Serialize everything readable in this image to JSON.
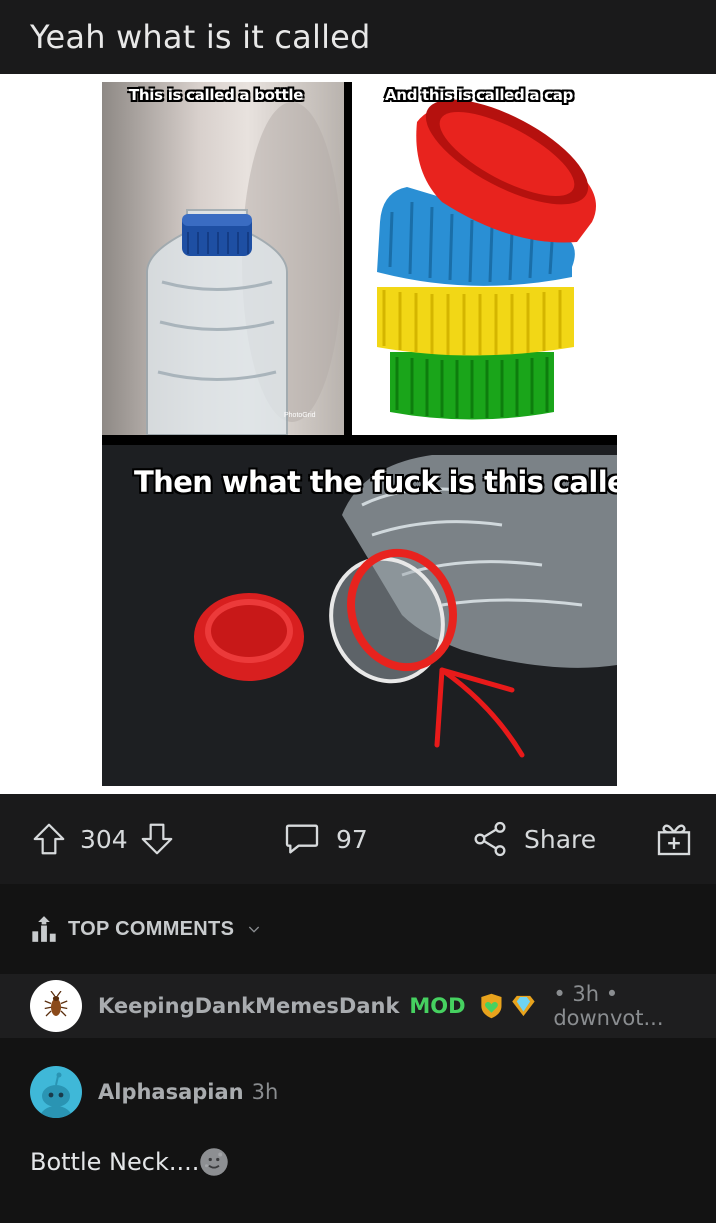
{
  "post": {
    "title": "Yeah what is it called",
    "meme": {
      "caption_top_left": "This is called a bottle",
      "caption_top_right": "And this is called a cap",
      "caption_bottom": "Then what the fuck is this called",
      "watermark": "PhotoGrid"
    },
    "actions": {
      "upvotes": "304",
      "comments": "97",
      "share_label": "Share"
    }
  },
  "comments_section": {
    "sort_label": "TOP COMMENTS",
    "mod_comment": {
      "username": "KeepingDankMemesDank",
      "mod_label": "MOD",
      "meta": "• 3h • downvot..."
    },
    "comments": [
      {
        "username": "Alphasapian",
        "time": "3h",
        "text": "Bottle Neck...."
      }
    ]
  },
  "colors": {
    "background": "#131313",
    "bar": "#1a1a1b",
    "mod_green": "#46d160",
    "text": "#d7dadc",
    "avatar_teal": "#3fb8d8"
  }
}
